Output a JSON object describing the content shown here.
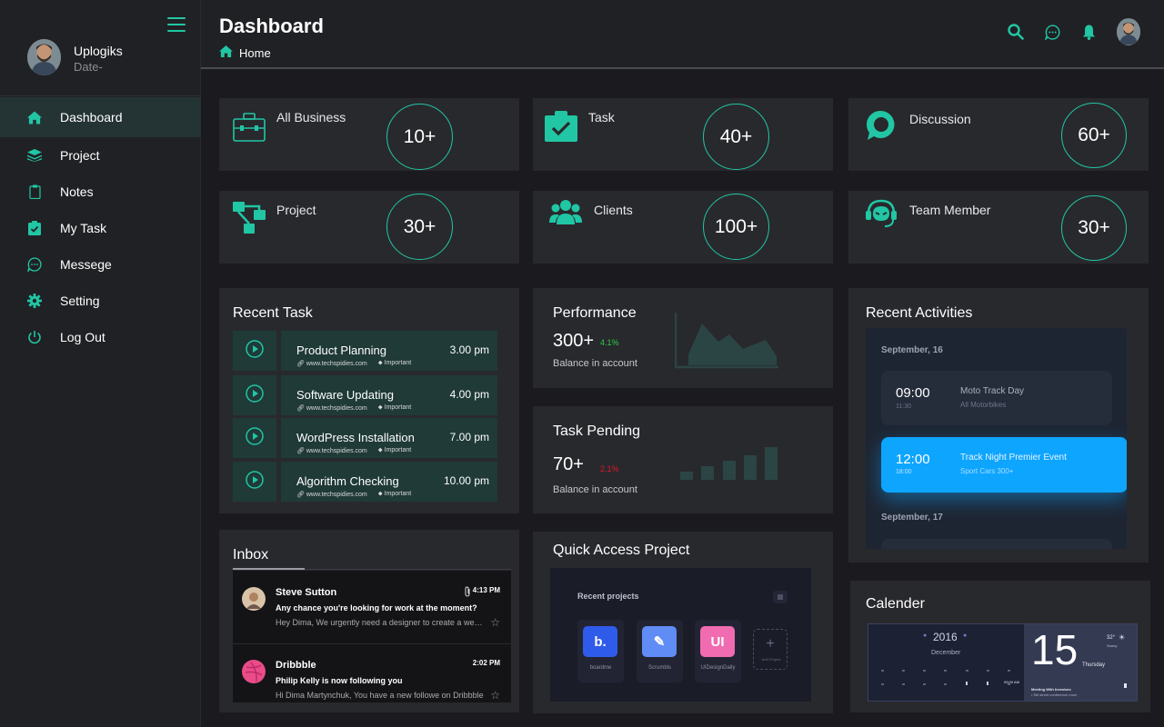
{
  "profile": {
    "name": "Uplogiks",
    "date": "Date-"
  },
  "nav": [
    {
      "label": "Dashboard",
      "icon": "home-icon"
    },
    {
      "label": "Project",
      "icon": "layers-icon"
    },
    {
      "label": "Notes",
      "icon": "clipboard-icon"
    },
    {
      "label": "My Task",
      "icon": "task-check-icon"
    },
    {
      "label": "Messege",
      "icon": "chat-icon"
    },
    {
      "label": "Setting",
      "icon": "gear-icon"
    },
    {
      "label": "Log Out",
      "icon": "power-icon"
    }
  ],
  "header": {
    "title": "Dashboard",
    "breadcrumb": "Home"
  },
  "stats": [
    {
      "label": "All Business",
      "value": "10+",
      "icon": "briefcase-icon"
    },
    {
      "label": "Task",
      "value": "40+",
      "icon": "task-check-icon"
    },
    {
      "label": "Discussion",
      "value": "60+",
      "icon": "discussion-icon"
    },
    {
      "label": "Project",
      "value": "30+",
      "icon": "sitemap-icon"
    },
    {
      "label": "Clients",
      "value": "100+",
      "icon": "users-icon"
    },
    {
      "label": "Team Member",
      "value": "30+",
      "icon": "headset-icon"
    }
  ],
  "recent_task": {
    "title": "Recent Task",
    "items": [
      {
        "name": "Product Planning",
        "time": "3.00 pm",
        "link": "www.techspidies.com",
        "tag": "Important"
      },
      {
        "name": "Software Updating",
        "time": "4.00 pm",
        "link": "www.techspidies.com",
        "tag": "Important"
      },
      {
        "name": "WordPress Installation",
        "time": "7.00 pm",
        "link": "www.techspidies.com",
        "tag": "Important"
      },
      {
        "name": "Algorithm Checking",
        "time": "10.00 pm",
        "link": "www.techspidies.com",
        "tag": "Important"
      }
    ]
  },
  "performance": {
    "title": "Performance",
    "value": "300+",
    "delta": "4.1%",
    "subtitle": "Balance in account",
    "delta_color": "#2ecc40"
  },
  "task_pending": {
    "title": "Task Pending",
    "value": "70+",
    "delta": "2.1%",
    "subtitle": "Balance in account",
    "delta_color": "#e0162b"
  },
  "recent_activities": {
    "title": "Recent Activities",
    "date1": "September, 16",
    "date2": "September, 17",
    "events": [
      {
        "time": "09:00",
        "sub_time": "11:30",
        "title": "Moto Track Day",
        "subtitle": "All Motorbikes"
      },
      {
        "time": "12:00",
        "sub_time": "18:00",
        "title": "Track Night Premier Event",
        "subtitle": "Sport Cars 300+"
      }
    ]
  },
  "inbox": {
    "title": "Inbox",
    "messages": [
      {
        "from": "Steve Sutton",
        "time": "4:13 PM",
        "subject": "Any chance you're looking for work at the moment?",
        "preview": "Hey Dima, We urgently need a designer to create a website and a mobile app"
      },
      {
        "from": "Dribbble",
        "time": "2:02 PM",
        "subject": "Philip Kelly is now following you",
        "preview": "Hi Dima Martynchuk, You have a new followe on Dribbble"
      }
    ]
  },
  "quick_access": {
    "title": "Quick Access Project",
    "panel_heading": "Recent projects",
    "projects": [
      {
        "name": "boardme",
        "initial": "b.",
        "color": "#2f5bea"
      },
      {
        "name": "Scrumbls",
        "initial": "✎",
        "color": "#5f8cf5"
      },
      {
        "name": "UIDesignDaily",
        "initial": "UI",
        "color": "#f06bb0"
      }
    ],
    "add_label": "Add Project"
  },
  "calendar": {
    "title": "Calender",
    "year": "2016",
    "month": "December",
    "day": "15",
    "weekday": "Thursday",
    "temp": "32°",
    "weather": "Sunny",
    "time": "09:00 AM",
    "event": "Meeting With Investors",
    "event_sub": "•  5th street conference room"
  },
  "colors": {
    "accent": "#21c6a4",
    "sidebar": "#202125",
    "card": "#28292d",
    "activity_blue": "#0ea5ff"
  }
}
